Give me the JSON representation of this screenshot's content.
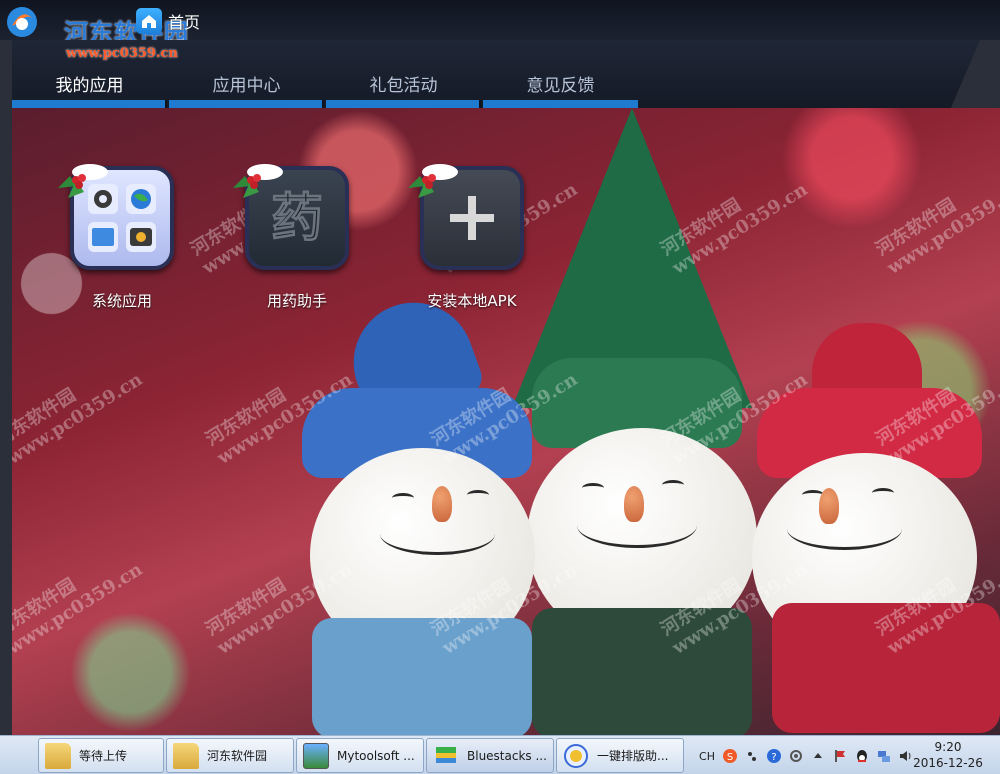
{
  "header": {
    "site_name": "河东软件园",
    "site_url": "www.pc0359.cn",
    "home_tab_label": "首页"
  },
  "nav": {
    "tabs": [
      {
        "label": "我的应用",
        "active": true
      },
      {
        "label": "应用中心",
        "active": false
      },
      {
        "label": "礼包活动",
        "active": false
      },
      {
        "label": "意见反馈",
        "active": false
      }
    ]
  },
  "apps": [
    {
      "label": "系统应用",
      "icon": "system-apps-icon"
    },
    {
      "label": "用药助手",
      "icon": "medicine-helper-icon",
      "glyph": "药"
    },
    {
      "label": "安装本地APK",
      "icon": "plus-icon"
    }
  ],
  "watermark": {
    "line1": "河东软件园",
    "line2": "www.pc0359.cn"
  },
  "taskbar": {
    "buttons": [
      {
        "label": "等待上传",
        "icon": "folder-icon"
      },
      {
        "label": "河东软件园",
        "icon": "folder-icon"
      },
      {
        "label": "Mytoolsoft ...",
        "icon": "image-app-icon"
      },
      {
        "label": "Bluestacks ...",
        "icon": "bluestacks-icon"
      },
      {
        "label": "一键排版助...",
        "icon": "typeset-icon"
      }
    ],
    "tray": {
      "ime": "CH",
      "time": "9:20",
      "date": "2016-12-26"
    }
  },
  "colors": {
    "accent": "#1f7bd0",
    "nav_bg": "#1a2030",
    "watermark_red": "#ff5a2a",
    "site_blue": "#2a7ad8"
  }
}
